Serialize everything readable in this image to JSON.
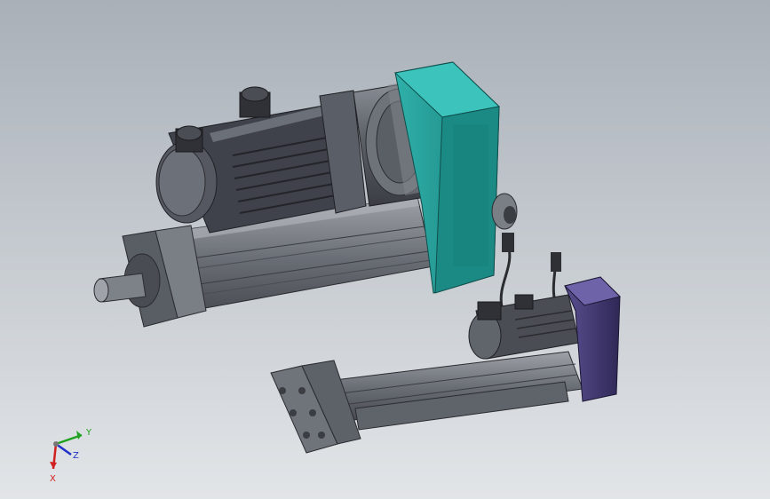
{
  "viewport": {
    "background_top": "#a9b0b8",
    "background_bottom": "#e2e5e8"
  },
  "colors": {
    "motor_dark": "#3c3f47",
    "motor_mid": "#5a5e66",
    "motor_light": "#80848c",
    "housing_teal": "#1f8f8a",
    "housing_teal_light": "#2fb0aa",
    "housing_purple": "#3b3466",
    "housing_purple_light": "#5a4f90",
    "actuator_grey": "#6f737a",
    "actuator_light": "#9ea2a8",
    "axis_x": "#d12020",
    "axis_y": "#1fa21f",
    "axis_z": "#2030c8"
  },
  "axis_triad": {
    "x_label": "X",
    "y_label": "Y",
    "z_label": "Z"
  }
}
